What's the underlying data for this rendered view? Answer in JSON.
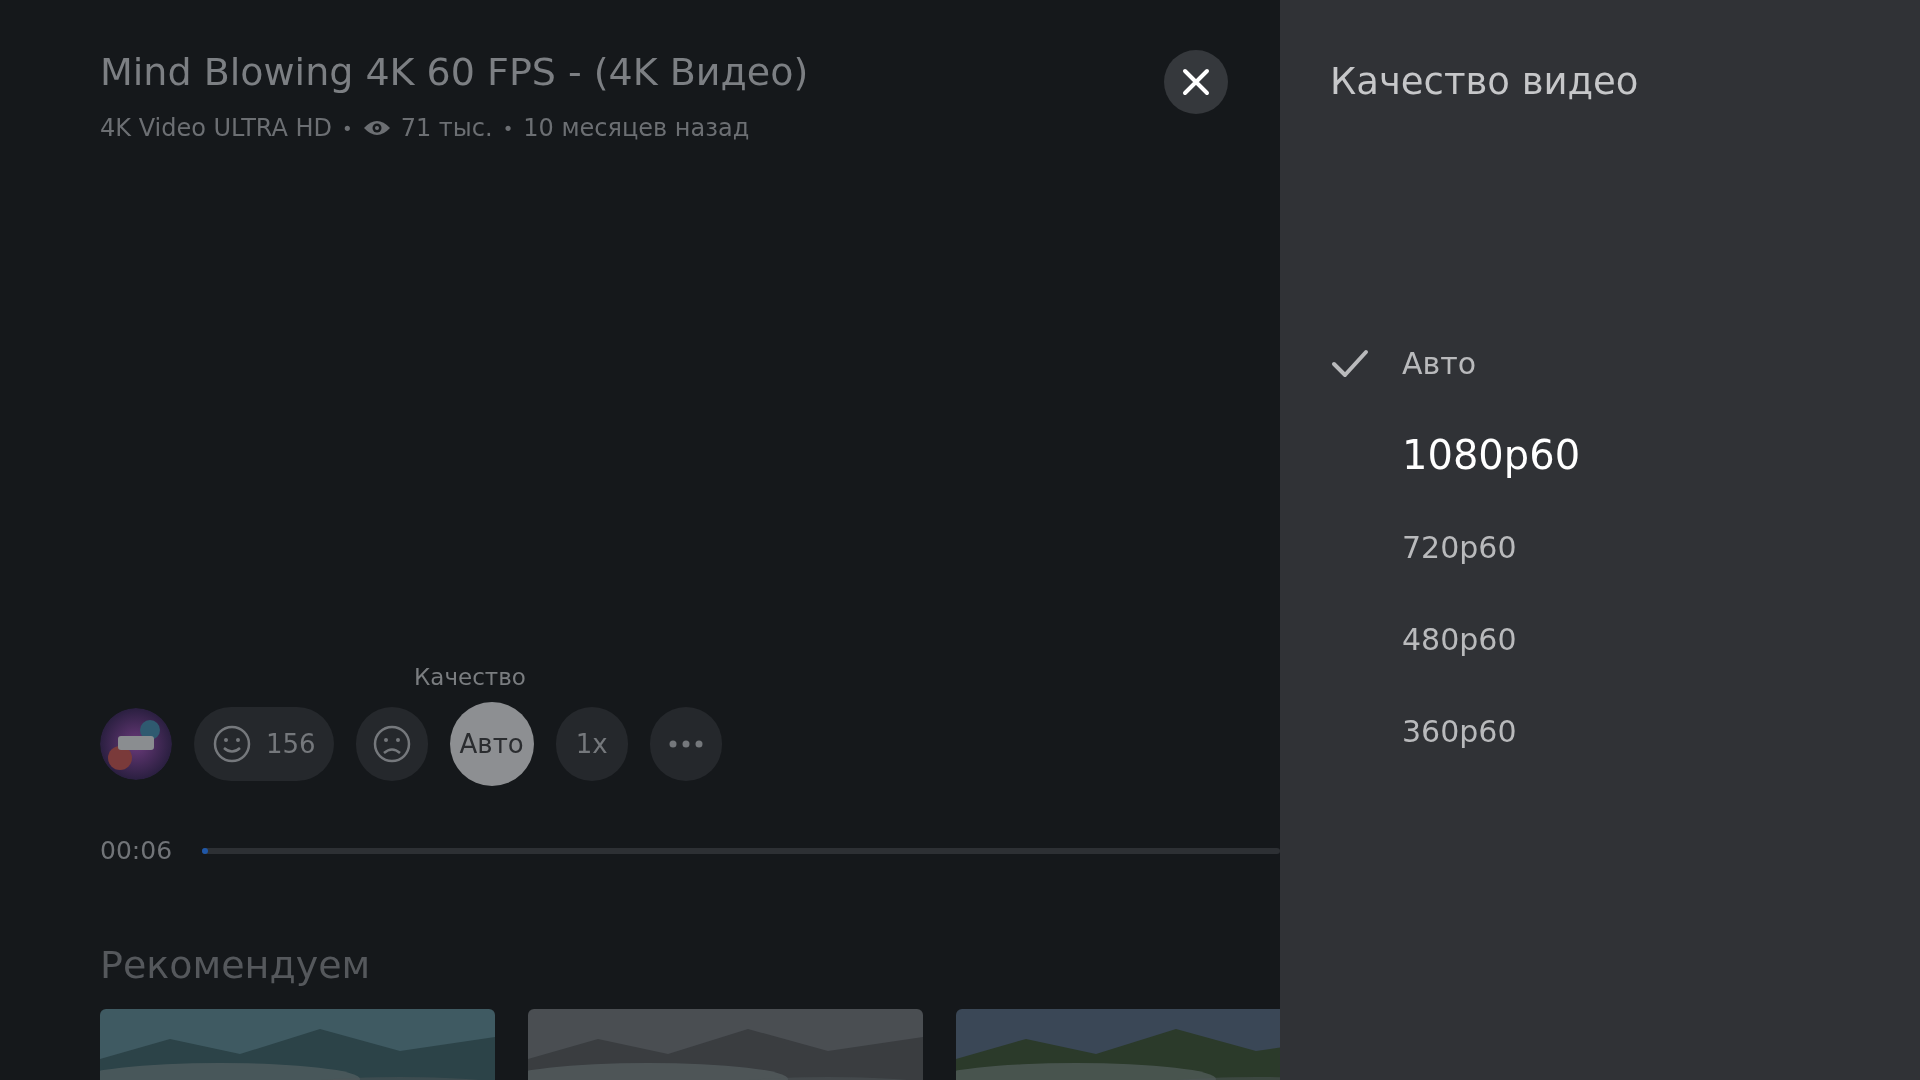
{
  "video": {
    "title": "Mind Blowing 4K 60 FPS - (4K Видео)",
    "channel": "4K Video ULTRA HD",
    "separator": "•",
    "views": "71 тыс.",
    "age": "10 месяцев назад"
  },
  "controls": {
    "hint": "Качество",
    "likes": "156",
    "quality": "Авто",
    "speed": "1x",
    "time": "00:06",
    "level": 0.005
  },
  "recommended": {
    "title": "Рекомендуем"
  },
  "panel": {
    "title": "Качество видео",
    "options": [
      {
        "label": "Авто",
        "selected": true,
        "focused": false
      },
      {
        "label": "1080p60",
        "selected": false,
        "focused": true
      },
      {
        "label": "720p60",
        "selected": false,
        "focused": false
      },
      {
        "label": "480p60",
        "selected": false,
        "focused": false
      },
      {
        "label": "360p60",
        "selected": false,
        "focused": false
      }
    ]
  }
}
